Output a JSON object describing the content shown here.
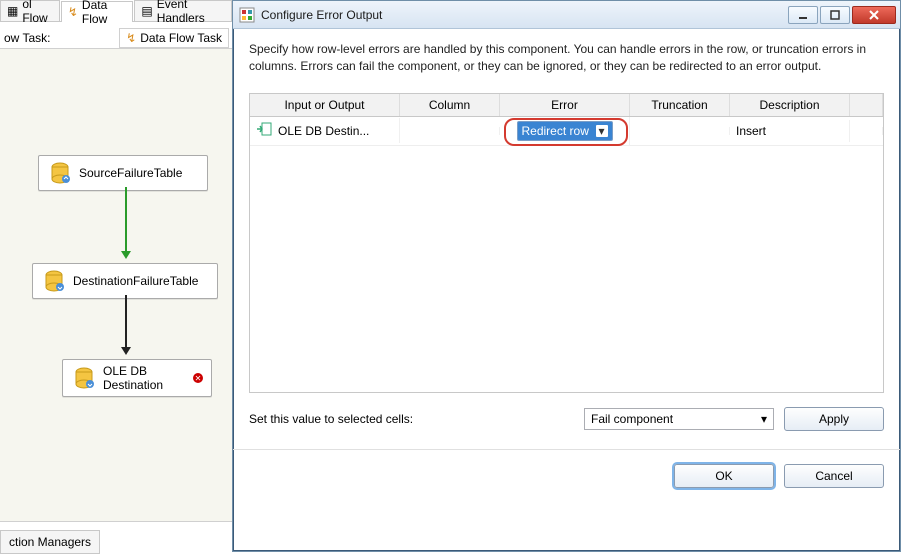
{
  "designer": {
    "tabs": [
      {
        "label": "ol Flow",
        "active": false
      },
      {
        "label": "Data Flow",
        "active": true
      },
      {
        "label": "Event Handlers",
        "active": false
      }
    ],
    "task_label": "ow Task:",
    "task_name": "Data Flow Task",
    "nodes": {
      "source": "SourceFailureTable",
      "dest": "DestinationFailureTable",
      "oledb_title": "OLE DB",
      "oledb_sub": "Destination"
    },
    "bottom_tab": "ction Managers"
  },
  "dialog": {
    "title": "Configure Error Output",
    "description": "Specify how row-level errors are handled by this component. You can handle errors in the row, or truncation errors in columns. Errors can fail the component, or they can be ignored, or they can be redirected to an error output.",
    "columns": {
      "c0": "Input or Output",
      "c1": "Column",
      "c2": "Error",
      "c3": "Truncation",
      "c4": "Description"
    },
    "row": {
      "input": "OLE DB Destin...",
      "column": "",
      "error": "Redirect row",
      "truncation": "",
      "desc": "Insert"
    },
    "footer_label": "Set this value to selected cells:",
    "footer_select": "Fail component",
    "apply": "Apply",
    "ok": "OK",
    "cancel": "Cancel"
  }
}
